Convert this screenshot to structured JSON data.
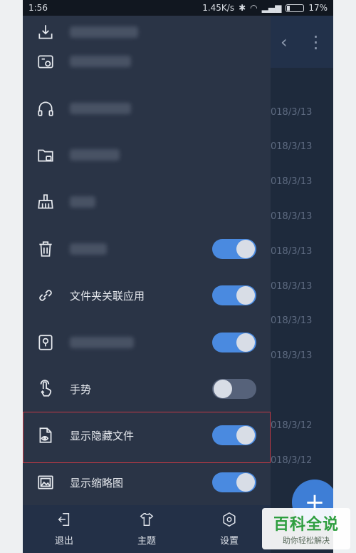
{
  "statusbar": {
    "time": "1:56",
    "net": "1.45K/s",
    "battery": "17%"
  },
  "background": {
    "dates": [
      "018/3/13",
      "018/3/13",
      "018/3/13",
      "018/3/13",
      "018/3/13",
      "018/3/13",
      "018/3/13",
      "018/3/13",
      "018/3/12",
      "018/3/12"
    ],
    "fab_icon": "+"
  },
  "menu": {
    "items": [
      {
        "name": "download",
        "label": "",
        "blurred": true,
        "toggle": null
      },
      {
        "name": "sd-card",
        "label": "",
        "blurred": true,
        "toggle": null
      },
      {
        "name": "headphones",
        "label": "",
        "blurred": true,
        "toggle": null
      },
      {
        "name": "locked-folder",
        "label": "",
        "blurred": true,
        "toggle": null
      },
      {
        "name": "cleaner",
        "label": "",
        "blurred": true,
        "toggle": null
      },
      {
        "name": "recycle-bin",
        "label": "",
        "blurred": true,
        "toggle": "on"
      },
      {
        "name": "folder-association",
        "label": "文件夹关联应用",
        "blurred": false,
        "toggle": "on"
      },
      {
        "name": "safe-box",
        "label": "",
        "blurred": true,
        "toggle": "on"
      },
      {
        "name": "gesture",
        "label": "手势",
        "blurred": false,
        "toggle": "off"
      },
      {
        "name": "show-hidden-files",
        "label": "显示隐藏文件",
        "blurred": false,
        "toggle": "on"
      },
      {
        "name": "show-thumbnails",
        "label": "显示缩略图",
        "blurred": false,
        "toggle": "on"
      }
    ]
  },
  "bottom_bar": {
    "exit": "退出",
    "theme": "主题",
    "settings": "设置"
  },
  "watermark": {
    "title": "百科全说",
    "subtitle": "助你轻松解决"
  },
  "colors": {
    "accent": "#4a8ae0",
    "highlight": "#c23a45",
    "drawer_bg": "#2a3446"
  }
}
